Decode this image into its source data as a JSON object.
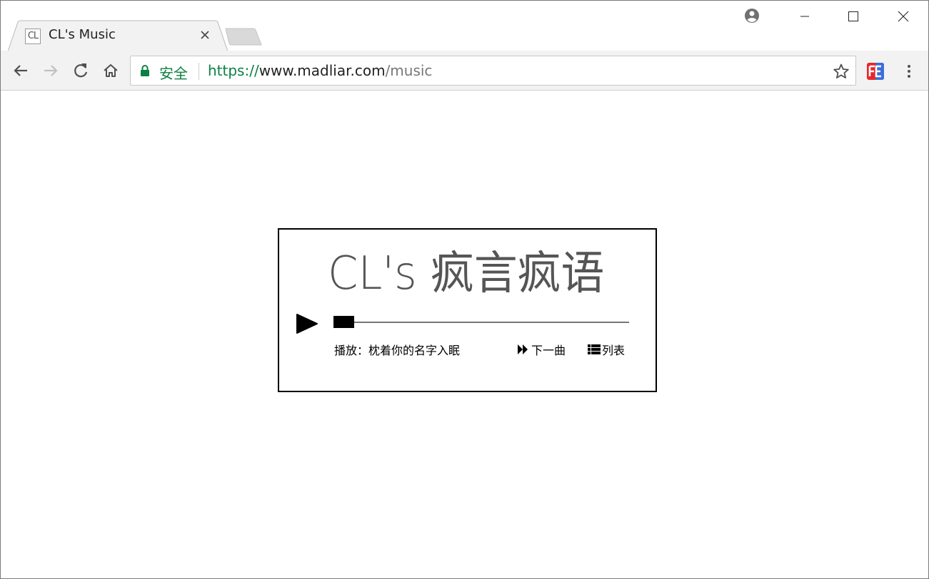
{
  "browser": {
    "tab": {
      "favicon_text": "CL",
      "title": "CL's Music",
      "close_glyph": "✕"
    },
    "omnibox": {
      "secure_label": "安全",
      "url_scheme": "https://",
      "url_host": "www.madliar.com",
      "url_path": "/music"
    },
    "icons": {
      "back": "arrow-left-icon",
      "forward": "arrow-right-icon",
      "reload": "reload-icon",
      "home": "home-icon",
      "lock": "lock-icon",
      "star": "star-icon",
      "extension": "fe-extension-icon",
      "menu": "kebab-menu-icon",
      "profile": "profile-icon",
      "minimize": "minimize-icon",
      "maximize": "maximize-icon",
      "close": "close-icon"
    },
    "colors": {
      "secure_green": "#0b8043",
      "toolbar_bg": "#f2f2f2"
    }
  },
  "player": {
    "title": "CL's 疯言疯语",
    "progress": 0.07,
    "now_playing": "播放：枕着你的名字入眠",
    "next_label": "下一曲",
    "list_label": "列表"
  }
}
